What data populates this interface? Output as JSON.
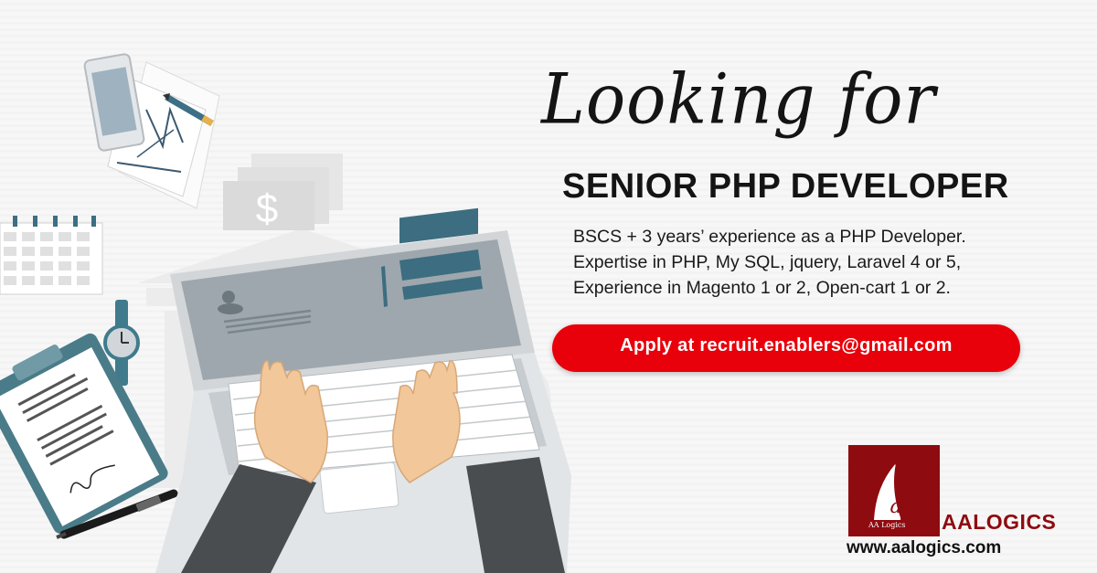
{
  "headline": "Looking for",
  "job_title": "SENIOR PHP DEVELOPER",
  "requirements": [
    "BSCS + 3 years’ experience as a PHP Developer.",
    "Expertise in PHP, My SQL, jquery, Laravel 4 or 5,",
    "Experience in Magento 1 or 2, Open-cart 1 or 2."
  ],
  "apply_button": "Apply at recruit.enablers@gmail.com",
  "brand": {
    "logo_text": "AA Logics",
    "name": "AALOGICS",
    "website": "www.aalogics.com"
  },
  "illustration": {
    "currency_symbol": "$",
    "icons": [
      "phone-icon",
      "pencil-icon",
      "document-icon",
      "money-stack-icon",
      "calendar-icon",
      "wristwatch-icon",
      "clipboard-icon",
      "pen-icon",
      "laptop-icon",
      "hands-icon"
    ]
  },
  "colors": {
    "accent_red": "#e8000b",
    "brand_maroon": "#8e0b10",
    "text_dark": "#141414",
    "laptop_screen": "#9ea7ad",
    "laptop_body": "#d9dcde",
    "sleeve": "#4a4d50",
    "skin": "#f2c79a"
  }
}
